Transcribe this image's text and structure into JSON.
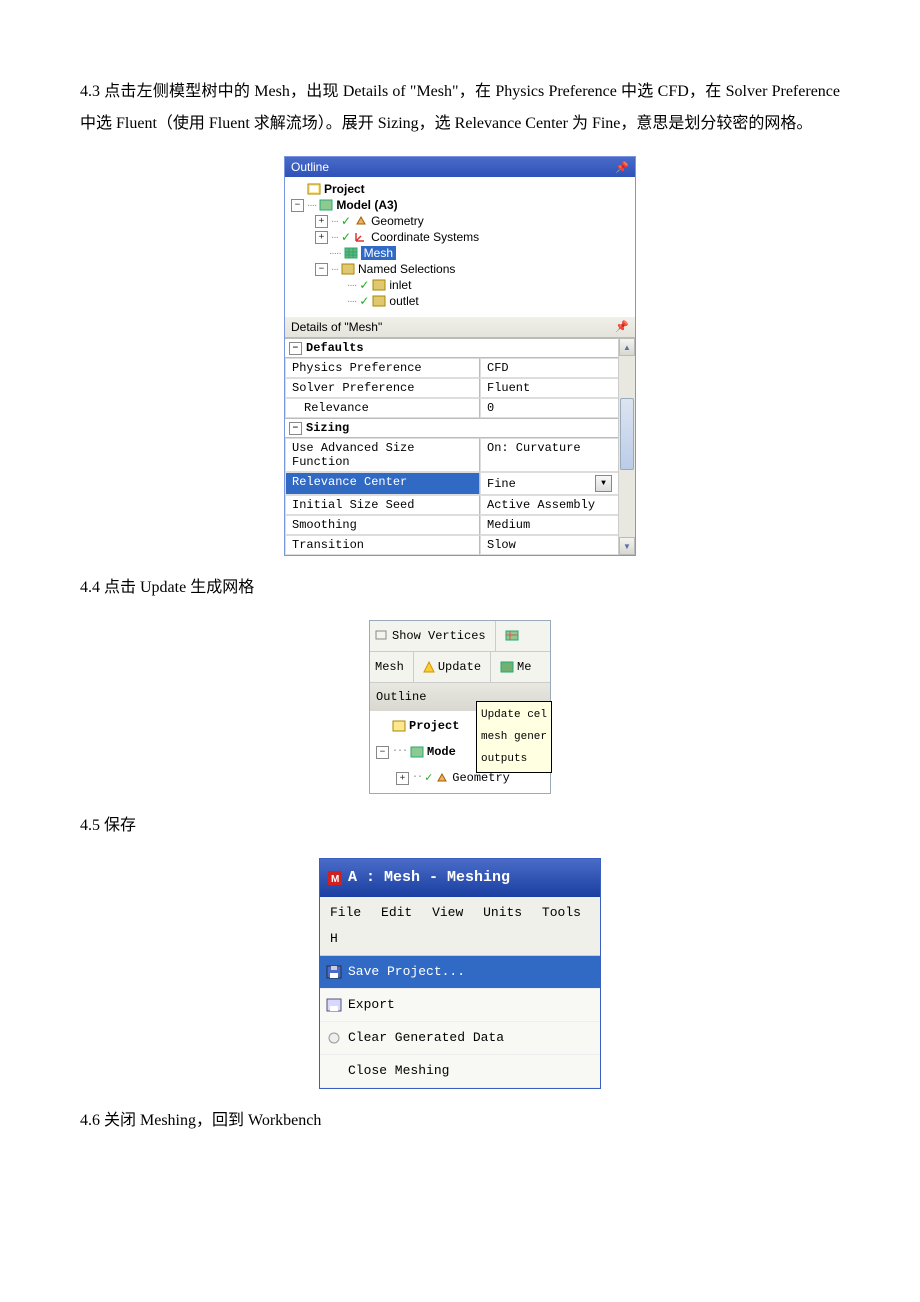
{
  "para43": "4.3 点击左侧模型树中的 Mesh，出现 Details of \"Mesh\"，在 Physics Preference 中选 CFD，在 Solver Preference 中选 Fluent（使用 Fluent 求解流场）。展开 Sizing，选 Relevance Center 为 Fine，意思是划分较密的网格。",
  "para44": "4.4 点击 Update 生成网格",
  "para45": "4.5 保存",
  "para46": "4.6 关闭 Meshing，回到 Workbench",
  "outline": {
    "title": "Outline",
    "project": "Project",
    "model": "Model (A3)",
    "geometry": "Geometry",
    "coord": "Coordinate Systems",
    "mesh": "Mesh",
    "named": "Named Selections",
    "inlet": "inlet",
    "outlet": "outlet"
  },
  "details": {
    "title": "Details of \"Mesh\"",
    "defaults": "Defaults",
    "phys_l": "Physics Preference",
    "phys_v": "CFD",
    "solv_l": "Solver Preference",
    "solv_v": "Fluent",
    "rel_l": "Relevance",
    "rel_v": "0",
    "sizing": "Sizing",
    "adv_l": "Use Advanced Size Function",
    "adv_v": "On: Curvature",
    "rc_l": "Relevance Center",
    "rc_v": "Fine",
    "seed_l": "Initial Size Seed",
    "seed_v": "Active Assembly",
    "smooth_l": "Smoothing",
    "smooth_v": "Medium",
    "trans_l": "Transition",
    "trans_v": "Slow"
  },
  "toolbar": {
    "show_vertices": "Show Vertices",
    "mesh": "Mesh",
    "update": "Update",
    "me": "Me",
    "outline": "Outline",
    "project": "Project",
    "mode": "Mode",
    "geometry": "Geometry",
    "tip1": "Update cel",
    "tip2": "mesh gener",
    "tip3": "outputs"
  },
  "win": {
    "title": "A : Mesh - Meshing",
    "file": "File",
    "edit": "Edit",
    "view": "View",
    "units": "Units",
    "tools": "Tools",
    "h": "H",
    "save": "Save Project...",
    "export": "Export",
    "clear": "Clear Generated Data",
    "close": "Close Meshing"
  }
}
